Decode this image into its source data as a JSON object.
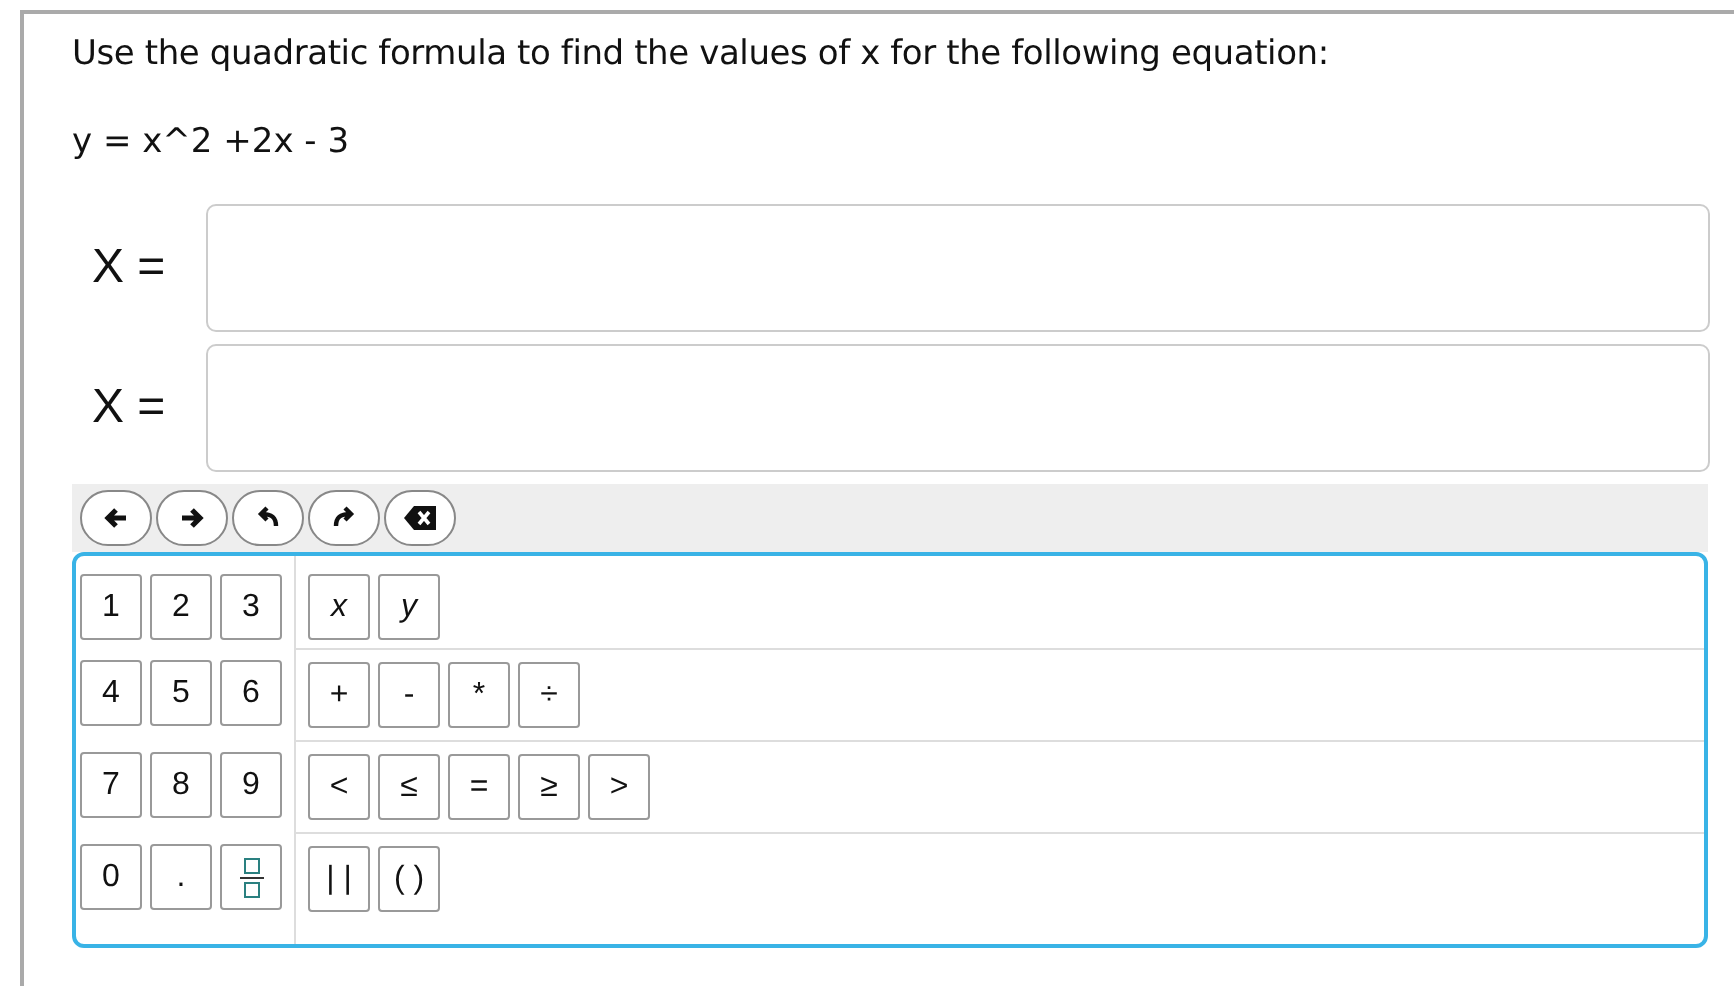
{
  "question": "Use the quadratic formula to find the values of x for the following equation:",
  "equation": "y = x^2 +2x - 3",
  "answers": [
    {
      "label": "X ="
    },
    {
      "label": "X ="
    }
  ],
  "tools": [
    {
      "kind": "left"
    },
    {
      "kind": "right"
    },
    {
      "kind": "undo"
    },
    {
      "kind": "redo"
    },
    {
      "kind": "backspace"
    }
  ],
  "keypad": [
    {
      "digits": [
        {
          "kind": "text",
          "label": "1"
        },
        {
          "kind": "text",
          "label": "2"
        },
        {
          "kind": "text",
          "label": "3"
        }
      ],
      "symbols": [
        {
          "kind": "variable",
          "label": "x"
        },
        {
          "kind": "variable",
          "label": "y"
        }
      ]
    },
    {
      "digits": [
        {
          "kind": "text",
          "label": "4"
        },
        {
          "kind": "text",
          "label": "5"
        },
        {
          "kind": "text",
          "label": "6"
        }
      ],
      "symbols": [
        {
          "kind": "text",
          "label": "+"
        },
        {
          "kind": "text",
          "label": "-"
        },
        {
          "kind": "text",
          "label": "*"
        },
        {
          "kind": "text",
          "label": "÷"
        }
      ]
    },
    {
      "digits": [
        {
          "kind": "text",
          "label": "7"
        },
        {
          "kind": "text",
          "label": "8"
        },
        {
          "kind": "text",
          "label": "9"
        }
      ],
      "symbols": [
        {
          "kind": "text",
          "label": "<"
        },
        {
          "kind": "text",
          "label": "≤"
        },
        {
          "kind": "text",
          "label": "="
        },
        {
          "kind": "text",
          "label": "≥"
        },
        {
          "kind": "text",
          "label": ">"
        }
      ]
    },
    {
      "digits": [
        {
          "kind": "text",
          "label": "0"
        },
        {
          "kind": "text",
          "label": "."
        },
        {
          "kind": "fraction"
        }
      ],
      "symbols": [
        {
          "kind": "text",
          "label": "| |"
        },
        {
          "kind": "text",
          "label": "( )"
        }
      ]
    }
  ]
}
